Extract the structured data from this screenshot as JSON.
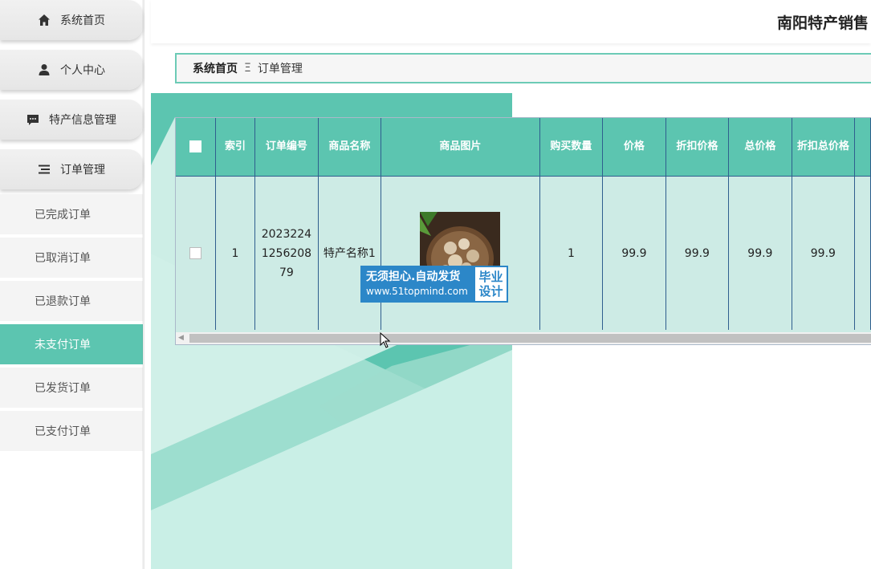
{
  "sidebar": {
    "menu": [
      {
        "label": "系统首页",
        "icon": "home-icon"
      },
      {
        "label": "个人中心",
        "icon": "user-icon"
      },
      {
        "label": "特产信息管理",
        "icon": "message-icon"
      },
      {
        "label": "订单管理",
        "icon": "list-icon"
      }
    ],
    "submenu": [
      {
        "label": "已完成订单",
        "active": false
      },
      {
        "label": "已取消订单",
        "active": false
      },
      {
        "label": "已退款订单",
        "active": false
      },
      {
        "label": "未支付订单",
        "active": true
      },
      {
        "label": "已发货订单",
        "active": false
      },
      {
        "label": "已支付订单",
        "active": false
      }
    ]
  },
  "header": {
    "title": "南阳特产销售"
  },
  "breadcrumb": {
    "home": "系统首页",
    "separator": "Ξ",
    "current": "订单管理"
  },
  "table": {
    "columns": [
      "索引",
      "订单编号",
      "商品名称",
      "商品图片",
      "购买数量",
      "价格",
      "折扣价格",
      "总价格",
      "折扣总价格"
    ],
    "rows": [
      {
        "index": "1",
        "order_no": "20232241256208 79",
        "product_name": "特产名称1",
        "image": "shiitake-mushrooms-photo",
        "quantity": "1",
        "price": "99.9",
        "discount_price": "99.9",
        "total_price": "99.9",
        "discount_total": "99.9"
      }
    ]
  },
  "watermark": {
    "line1": "无须担心.自动发货",
    "line2": "www.51topmind.com",
    "badge1": "毕业",
    "badge2": "设计"
  },
  "colors": {
    "accent": "#5cc5b0",
    "header_text": "#ffffff",
    "row_bg": "#cdebe5"
  }
}
